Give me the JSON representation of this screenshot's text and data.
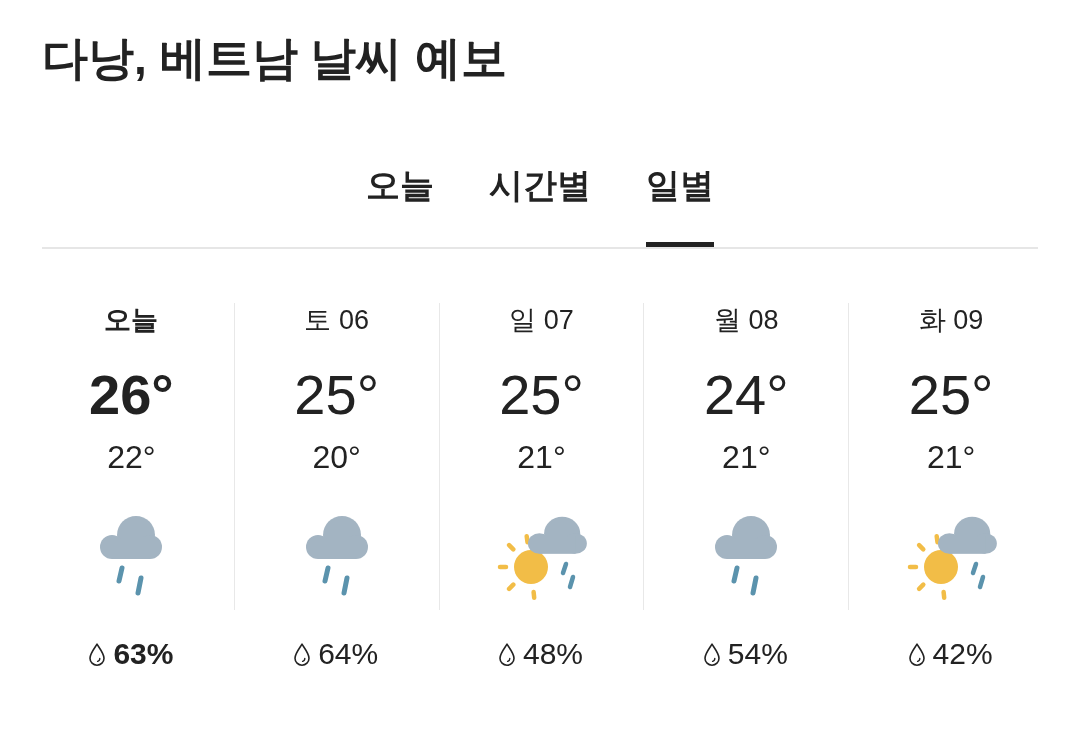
{
  "title": "다낭, 베트남 날씨 예보",
  "tabs": [
    {
      "label": "오늘",
      "selected": false
    },
    {
      "label": "시간별",
      "selected": false
    },
    {
      "label": "일별",
      "selected": true
    }
  ],
  "days": [
    {
      "label": "오늘",
      "selected": true,
      "high": "26°",
      "low": "22°",
      "kind": "rain",
      "precipitation": "63%"
    },
    {
      "label": "토 06",
      "selected": false,
      "high": "25°",
      "low": "20°",
      "kind": "rain",
      "precipitation": "64%"
    },
    {
      "label": "일 07",
      "selected": false,
      "high": "25°",
      "low": "21°",
      "kind": "sun-rain",
      "precipitation": "48%"
    },
    {
      "label": "월 08",
      "selected": false,
      "high": "24°",
      "low": "21°",
      "kind": "rain",
      "precipitation": "54%"
    },
    {
      "label": "화 09",
      "selected": false,
      "high": "25°",
      "low": "21°",
      "kind": "sun-rain",
      "precipitation": "42%"
    }
  ]
}
